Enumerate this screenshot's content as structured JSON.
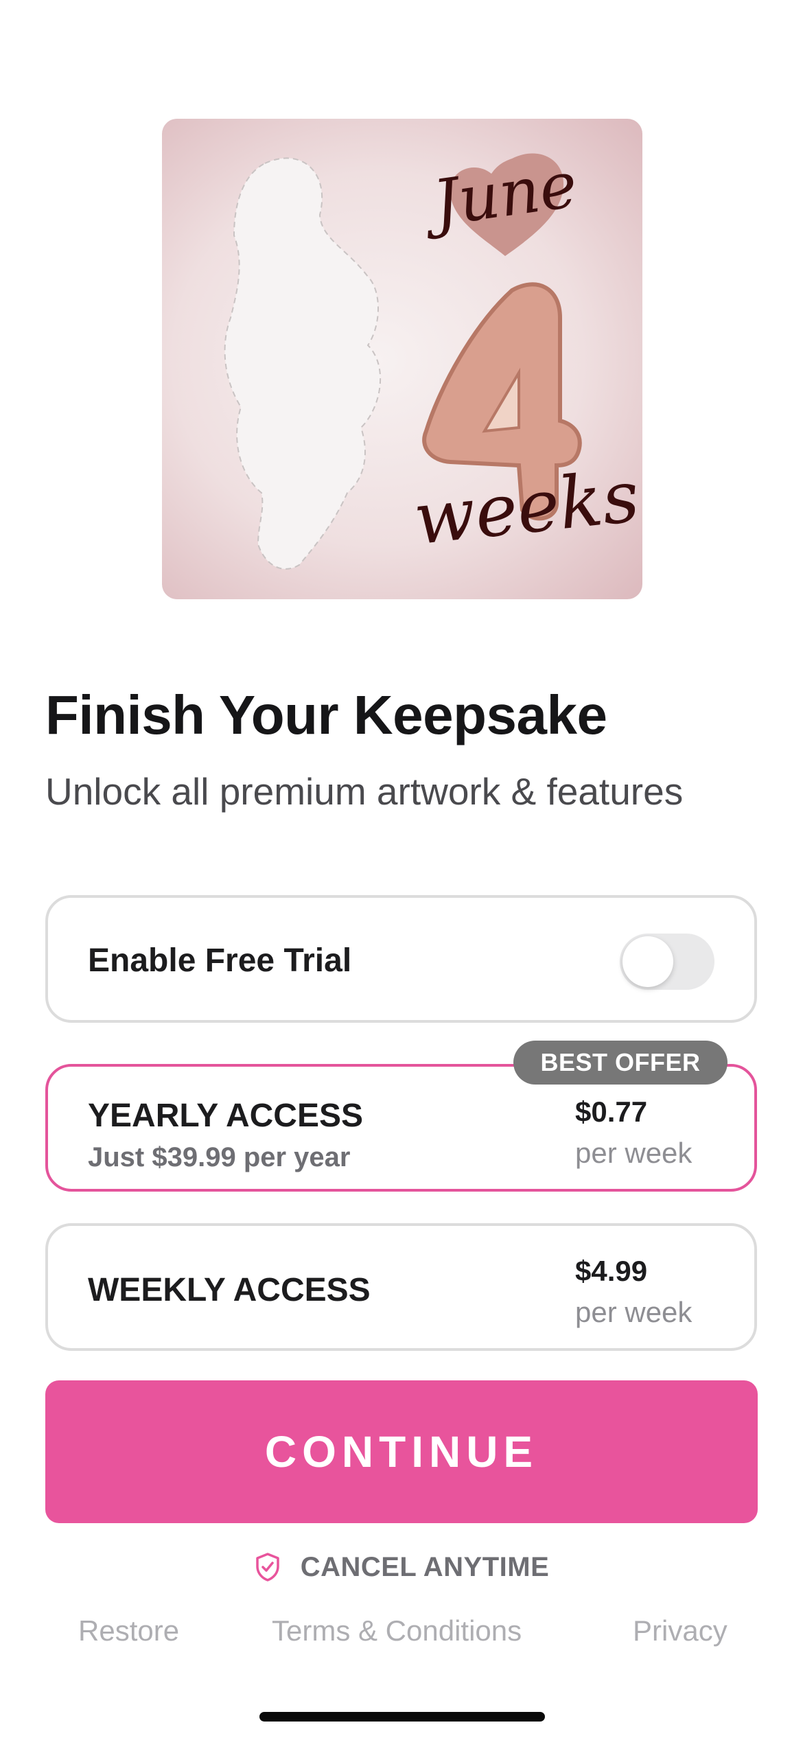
{
  "hero": {
    "month_text": "June",
    "number_text": "4",
    "unit_text": "weeks"
  },
  "headline": "Finish Your Keepsake",
  "subheadline": "Unlock all premium artwork & features",
  "free_trial": {
    "label": "Enable Free Trial",
    "enabled": false
  },
  "plans": [
    {
      "name": "YEARLY ACCESS",
      "subtitle": "Just $39.99 per year",
      "price": "$0.77",
      "per": "per week",
      "badge": "BEST OFFER",
      "selected": true
    },
    {
      "name": "WEEKLY ACCESS",
      "price": "$4.99",
      "per": "per week",
      "selected": false
    }
  ],
  "cta_label": "CONTINUE",
  "cancel_text": "CANCEL ANYTIME",
  "footer": {
    "restore": "Restore",
    "terms": "Terms & Conditions",
    "privacy": "Privacy"
  },
  "colors": {
    "accent": "#e8549c",
    "badge": "#777777",
    "card_border": "#dcdcdc"
  }
}
